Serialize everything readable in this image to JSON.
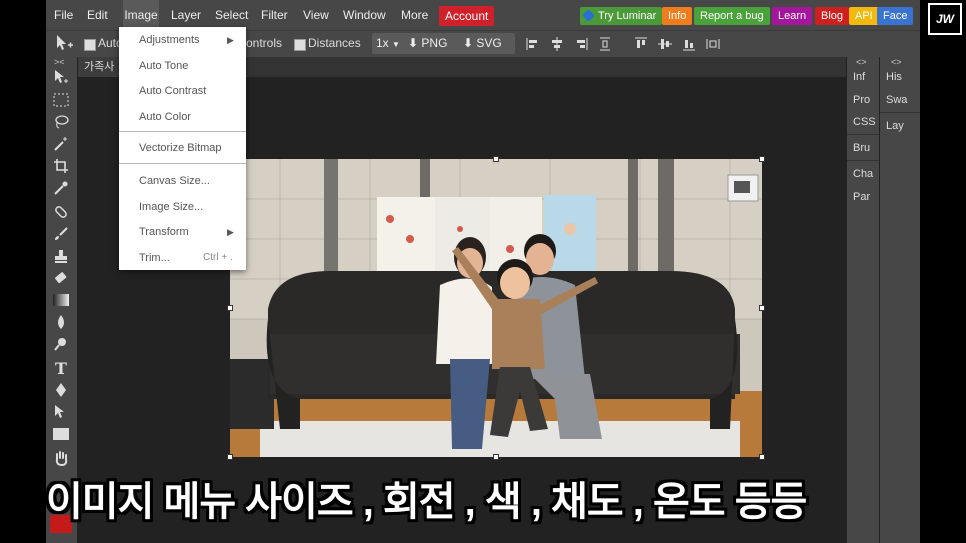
{
  "menubar": {
    "items": [
      "File",
      "Edit",
      "Image",
      "Layer",
      "Select",
      "Filter",
      "View",
      "Window",
      "More"
    ],
    "account": "Account",
    "right_buttons": [
      {
        "label": "Try Luminar",
        "color": "#4a9a3a"
      },
      {
        "label": "Info",
        "color": "#ef7d1e"
      },
      {
        "label": "Report a bug",
        "color": "#4aa23b"
      },
      {
        "label": "Learn",
        "color": "#a4179c"
      },
      {
        "label": "Blog",
        "color": "#cf2020"
      },
      {
        "label": "API",
        "color": "#f2b90f"
      },
      {
        "label": "Face",
        "color": "#3a73d0"
      }
    ]
  },
  "toolbar": {
    "auto_label": "Auto",
    "controls_label": "ontrols",
    "distances_label": "Distances",
    "zoom": "1x",
    "png_label": "PNG",
    "svg_label": "SVG"
  },
  "document": {
    "tab_title": "가족사"
  },
  "image_menu": {
    "adjustments": "Adjustments",
    "auto_tone": "Auto Tone",
    "auto_contrast": "Auto Contrast",
    "auto_color": "Auto Color",
    "vectorize": "Vectorize Bitmap",
    "canvas_size": "Canvas Size...",
    "image_size": "Image Size...",
    "transform": "Transform",
    "trim": "Trim...",
    "trim_shortcut": "Ctrl + ."
  },
  "right_panel_1": [
    "Inf",
    "Pro",
    "CSS",
    "Bru",
    "Cha",
    "Par"
  ],
  "right_panel_2": [
    "His",
    "Swa",
    "Lay"
  ],
  "subtitle": "이미지 메뉴 사이즈 , 회전 , 색 , 채도 , 온도 등등",
  "logo_text": "JW",
  "colors": {
    "accent_account": "#d0202a",
    "swatch": "#c41a1a"
  }
}
